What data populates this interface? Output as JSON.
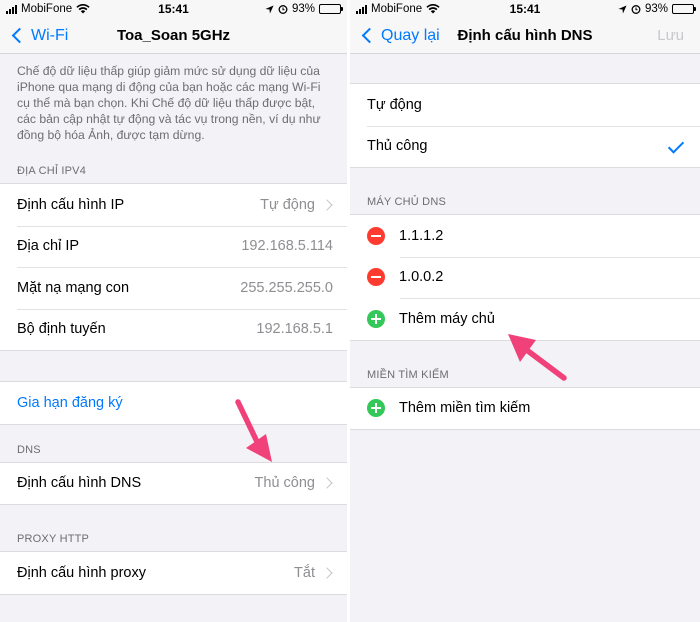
{
  "status_bar": {
    "carrier": "MobiFone",
    "time": "15:41",
    "battery": "93%",
    "battery_level": 0.93
  },
  "left": {
    "nav": {
      "back_label": "Wi-Fi",
      "title": "Toa_Soan 5GHz"
    },
    "description": "Chế độ dữ liệu thấp giúp giảm mức sử dụng dữ liệu của iPhone qua mạng di động của bạn hoặc các mạng Wi-Fi cụ thể mà bạn chọn. Khi Chế độ dữ liệu thấp được bật, các bản cập nhật tự động và tác vụ trong nền, ví dụ như đồng bộ hóa Ảnh, được tạm dừng.",
    "ipv4": {
      "header": "ĐỊA CHỈ IPV4",
      "rows": [
        {
          "label": "Định cấu hình IP",
          "value": "Tự động"
        },
        {
          "label": "Địa chỉ IP",
          "value": "192.168.5.114"
        },
        {
          "label": "Mặt nạ mạng con",
          "value": "255.255.255.0"
        },
        {
          "label": "Bộ định tuyến",
          "value": "192.168.5.1"
        }
      ]
    },
    "renew_lease": "Gia hạn đăng ký",
    "dns": {
      "header": "DNS",
      "label": "Định cấu hình DNS",
      "value": "Thủ công"
    },
    "proxy": {
      "header": "PROXY HTTP",
      "label": "Định cấu hình proxy",
      "value": "Tắt"
    }
  },
  "right": {
    "nav": {
      "back_label": "Quay lại",
      "title": "Định cấu hình DNS",
      "save_label": "Lưu"
    },
    "modes": [
      {
        "label": "Tự động"
      },
      {
        "label": "Thủ công"
      }
    ],
    "servers": {
      "header": "MÁY CHỦ DNS",
      "items": [
        "1.1.1.2",
        "1.0.0.2"
      ],
      "add_label": "Thêm máy chủ"
    },
    "search_domains": {
      "header": "MIỀN TÌM KIẾM",
      "add_label": "Thêm miền tìm kiếm"
    }
  },
  "colors": {
    "accent": "#007aff",
    "delete": "#ff3b30",
    "add": "#34c759",
    "annotation": "#f0417a"
  }
}
